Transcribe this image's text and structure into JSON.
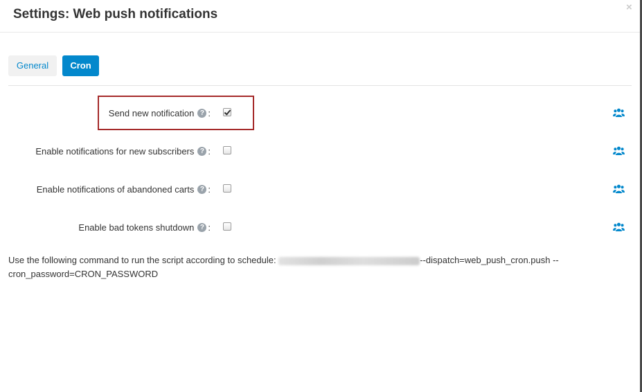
{
  "header": {
    "title": "Settings: Web push notifications",
    "close_label": "×"
  },
  "tabs": [
    {
      "label": "General",
      "active": false
    },
    {
      "label": "Cron",
      "active": true
    }
  ],
  "settings": [
    {
      "label": "Send new notification",
      "checked": true
    },
    {
      "label": "Enable notifications for new subscribers",
      "checked": false
    },
    {
      "label": "Enable notifications of abandoned carts",
      "checked": false
    },
    {
      "label": "Enable bad tokens shutdown",
      "checked": false
    }
  ],
  "help_glyph": "?",
  "colon": ":",
  "cron": {
    "prefix": "Use the following command to run the script according to schedule:",
    "suffix": "--dispatch=web_push_cron.push --cron_password=CRON_PASSWORD"
  },
  "icons": {
    "setting_scope": "users-icon",
    "help": "question-circle-icon",
    "close": "close-icon"
  },
  "colors": {
    "accent": "#0388cc",
    "highlight_border": "#a52a2a",
    "help_icon": "#9aa3ab"
  }
}
